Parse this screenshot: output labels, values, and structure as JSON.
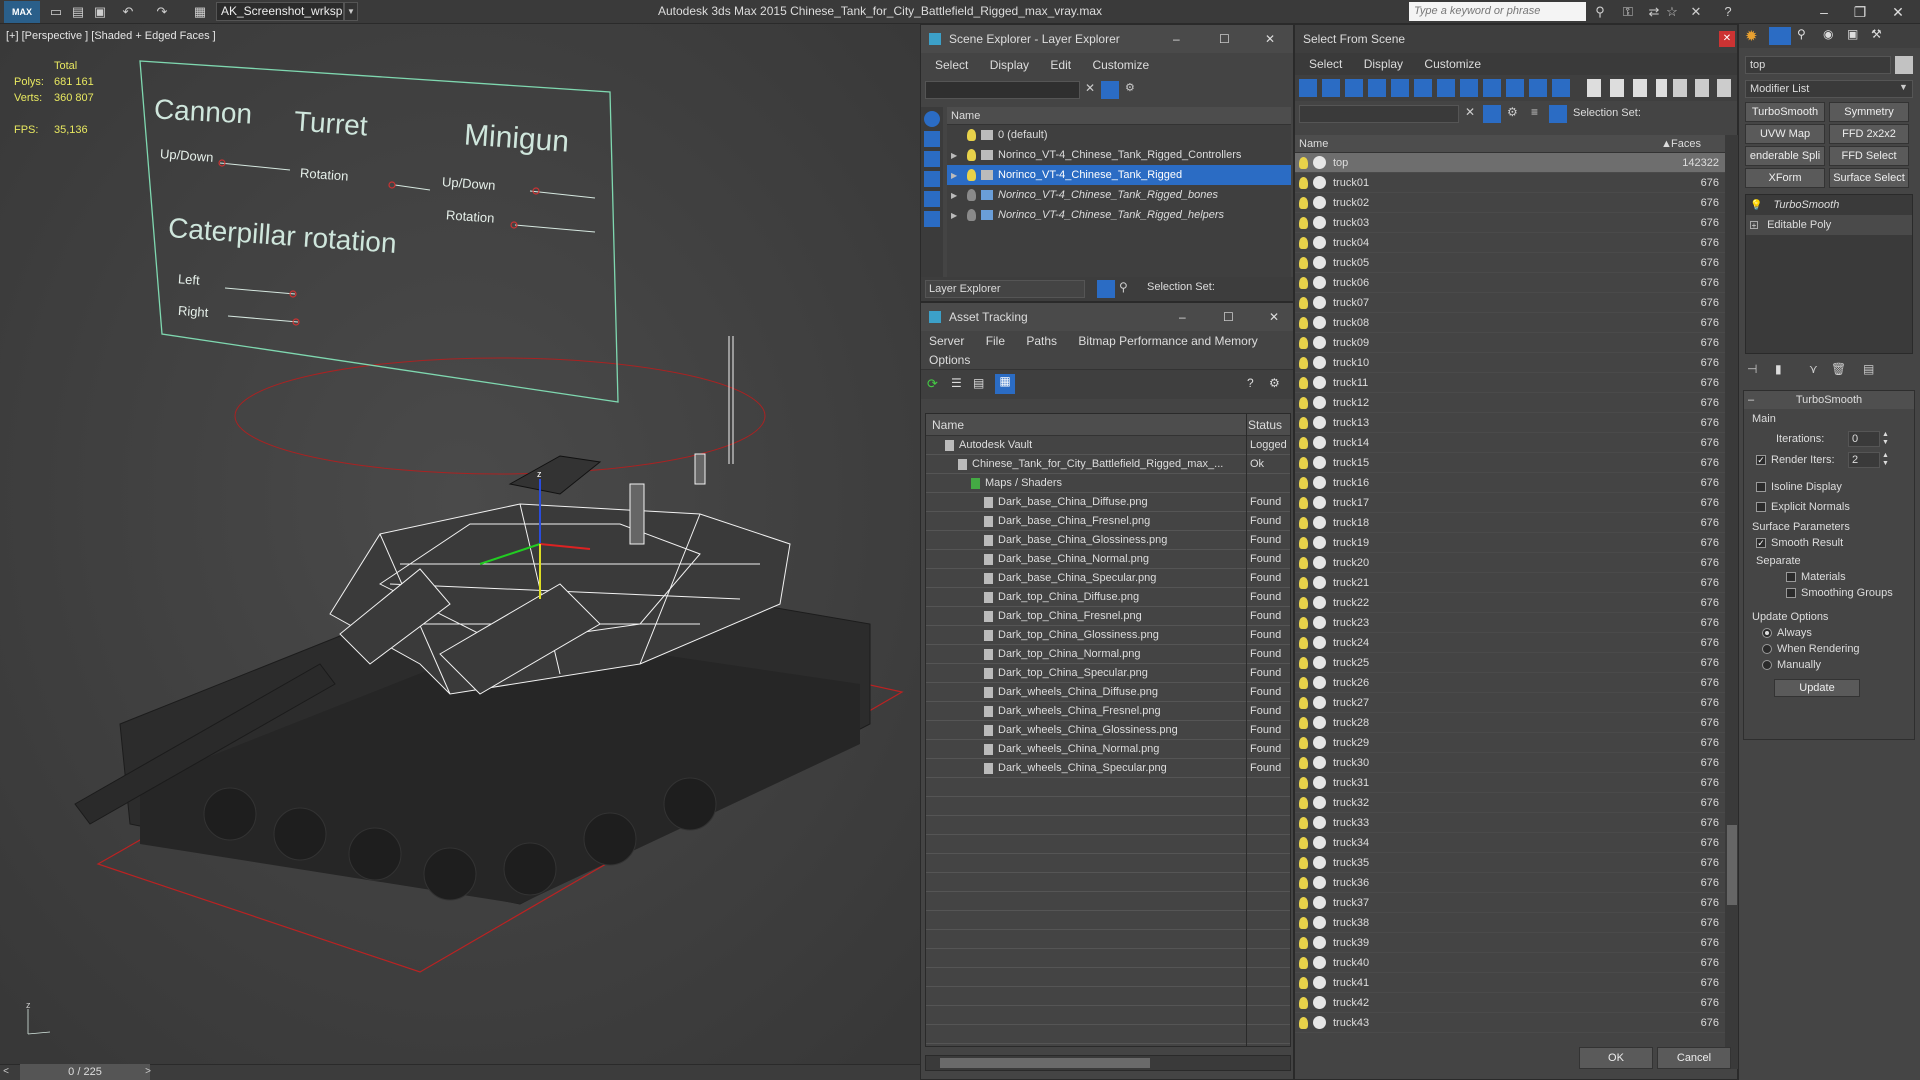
{
  "titlebar": {
    "logo": "MAX",
    "workspace": "AK_Screenshot_wrksp",
    "app_title": "Autodesk 3ds Max  2015     Chinese_Tank_for_City_Battlefield_Rigged_max_vray.max",
    "search_placeholder": "Type a keyword or phrase"
  },
  "viewport": {
    "label": "[+] [Perspective ] [Shaded + Edged Faces ]",
    "stats": {
      "total_label": "Total",
      "polys_label": "Polys:",
      "polys": "681 161",
      "verts_label": "Verts:",
      "verts": "360 807",
      "fps_label": "FPS:",
      "fps": "35,136"
    },
    "rig_panel": {
      "cannon": "Cannon",
      "cannon_updown": "Up/Down",
      "turret": "Turret",
      "turret_rotation": "Rotation",
      "minigun": "Minigun",
      "minigun_updown": "Up/Down",
      "minigun_rotation": "Rotation",
      "caterpillar": "Caterpillar rotation",
      "left": "Left",
      "right": "Right"
    },
    "time_slider": "0 / 225",
    "axis_z": "z"
  },
  "scene_explorer": {
    "title": "Scene Explorer - Layer Explorer",
    "menu": [
      "Select",
      "Display",
      "Edit",
      "Customize"
    ],
    "column": "Name",
    "layers": [
      {
        "name": "0 (default)",
        "expand": ""
      },
      {
        "name": "Norinco_VT-4_Chinese_Tank_Rigged_Controllers",
        "expand": "▶"
      },
      {
        "name": "Norinco_VT-4_Chinese_Tank_Rigged",
        "expand": "▶"
      },
      {
        "name": "Norinco_VT-4_Chinese_Tank_Rigged_bones",
        "expand": "▶"
      },
      {
        "name": "Norinco_VT-4_Chinese_Tank_Rigged_helpers",
        "expand": "▶"
      }
    ],
    "footer_label": "Layer Explorer",
    "selection_set": "Selection Set:"
  },
  "asset_tracking": {
    "title": "Asset Tracking",
    "menu": [
      "Server",
      "File",
      "Paths",
      "Bitmap Performance and Memory"
    ],
    "menu2": "Options",
    "col_name": "Name",
    "col_status": "Status",
    "rows": [
      {
        "name": "Autodesk Vault",
        "status": "Logged",
        "indent": 1
      },
      {
        "name": "Chinese_Tank_for_City_Battlefield_Rigged_max_...",
        "status": "Ok",
        "indent": 2
      },
      {
        "name": "Maps / Shaders",
        "status": "",
        "indent": 3
      },
      {
        "name": "Dark_base_China_Diffuse.png",
        "status": "Found",
        "indent": 4
      },
      {
        "name": "Dark_base_China_Fresnel.png",
        "status": "Found",
        "indent": 4
      },
      {
        "name": "Dark_base_China_Glossiness.png",
        "status": "Found",
        "indent": 4
      },
      {
        "name": "Dark_base_China_Normal.png",
        "status": "Found",
        "indent": 4
      },
      {
        "name": "Dark_base_China_Specular.png",
        "status": "Found",
        "indent": 4
      },
      {
        "name": "Dark_top_China_Diffuse.png",
        "status": "Found",
        "indent": 4
      },
      {
        "name": "Dark_top_China_Fresnel.png",
        "status": "Found",
        "indent": 4
      },
      {
        "name": "Dark_top_China_Glossiness.png",
        "status": "Found",
        "indent": 4
      },
      {
        "name": "Dark_top_China_Normal.png",
        "status": "Found",
        "indent": 4
      },
      {
        "name": "Dark_top_China_Specular.png",
        "status": "Found",
        "indent": 4
      },
      {
        "name": "Dark_wheels_China_Diffuse.png",
        "status": "Found",
        "indent": 4
      },
      {
        "name": "Dark_wheels_China_Fresnel.png",
        "status": "Found",
        "indent": 4
      },
      {
        "name": "Dark_wheels_China_Glossiness.png",
        "status": "Found",
        "indent": 4
      },
      {
        "name": "Dark_wheels_China_Normal.png",
        "status": "Found",
        "indent": 4
      },
      {
        "name": "Dark_wheels_China_Specular.png",
        "status": "Found",
        "indent": 4
      }
    ]
  },
  "select_from_scene": {
    "title": "Select From Scene",
    "menu": [
      "Select",
      "Display",
      "Customize"
    ],
    "selection_set": "Selection Set:",
    "col_name": "Name",
    "col_faces": "Faces",
    "items": [
      {
        "name": "top",
        "faces": "142322"
      },
      {
        "name": "truck01",
        "faces": "676"
      },
      {
        "name": "truck02",
        "faces": "676"
      },
      {
        "name": "truck03",
        "faces": "676"
      },
      {
        "name": "truck04",
        "faces": "676"
      },
      {
        "name": "truck05",
        "faces": "676"
      },
      {
        "name": "truck06",
        "faces": "676"
      },
      {
        "name": "truck07",
        "faces": "676"
      },
      {
        "name": "truck08",
        "faces": "676"
      },
      {
        "name": "truck09",
        "faces": "676"
      },
      {
        "name": "truck10",
        "faces": "676"
      },
      {
        "name": "truck11",
        "faces": "676"
      },
      {
        "name": "truck12",
        "faces": "676"
      },
      {
        "name": "truck13",
        "faces": "676"
      },
      {
        "name": "truck14",
        "faces": "676"
      },
      {
        "name": "truck15",
        "faces": "676"
      },
      {
        "name": "truck16",
        "faces": "676"
      },
      {
        "name": "truck17",
        "faces": "676"
      },
      {
        "name": "truck18",
        "faces": "676"
      },
      {
        "name": "truck19",
        "faces": "676"
      },
      {
        "name": "truck20",
        "faces": "676"
      },
      {
        "name": "truck21",
        "faces": "676"
      },
      {
        "name": "truck22",
        "faces": "676"
      },
      {
        "name": "truck23",
        "faces": "676"
      },
      {
        "name": "truck24",
        "faces": "676"
      },
      {
        "name": "truck25",
        "faces": "676"
      },
      {
        "name": "truck26",
        "faces": "676"
      },
      {
        "name": "truck27",
        "faces": "676"
      },
      {
        "name": "truck28",
        "faces": "676"
      },
      {
        "name": "truck29",
        "faces": "676"
      },
      {
        "name": "truck30",
        "faces": "676"
      },
      {
        "name": "truck31",
        "faces": "676"
      },
      {
        "name": "truck32",
        "faces": "676"
      },
      {
        "name": "truck33",
        "faces": "676"
      },
      {
        "name": "truck34",
        "faces": "676"
      },
      {
        "name": "truck35",
        "faces": "676"
      },
      {
        "name": "truck36",
        "faces": "676"
      },
      {
        "name": "truck37",
        "faces": "676"
      },
      {
        "name": "truck38",
        "faces": "676"
      },
      {
        "name": "truck39",
        "faces": "676"
      },
      {
        "name": "truck40",
        "faces": "676"
      },
      {
        "name": "truck41",
        "faces": "676"
      },
      {
        "name": "truck42",
        "faces": "676"
      },
      {
        "name": "truck43",
        "faces": "676"
      }
    ],
    "ok": "OK",
    "cancel": "Cancel"
  },
  "command_panel": {
    "object_name": "top",
    "modifier_list": "Modifier List",
    "buttons": [
      "TurboSmooth",
      "Symmetry",
      "UVW Map",
      "FFD 2x2x2",
      "enderable Spli",
      "FFD Select",
      "XForm",
      "Surface Select"
    ],
    "stack": [
      "TurboSmooth",
      "Editable Poly"
    ],
    "rollout_title": "TurboSmooth",
    "main": "Main",
    "iterations_label": "Iterations:",
    "iterations": "0",
    "render_iters_label": "Render Iters:",
    "render_iters": "2",
    "isoline": "Isoline Display",
    "explicit_normals": "Explicit Normals",
    "surface_params": "Surface Parameters",
    "smooth_result": "Smooth Result",
    "separate": "Separate",
    "materials": "Materials",
    "smoothing_groups": "Smoothing Groups",
    "update_options": "Update Options",
    "always": "Always",
    "when_rendering": "When Rendering",
    "manually": "Manually",
    "update": "Update"
  },
  "colors": {
    "accent": "#2b6cc4",
    "rig_lines": "#7fd8b0",
    "stats": "#e8e860"
  }
}
